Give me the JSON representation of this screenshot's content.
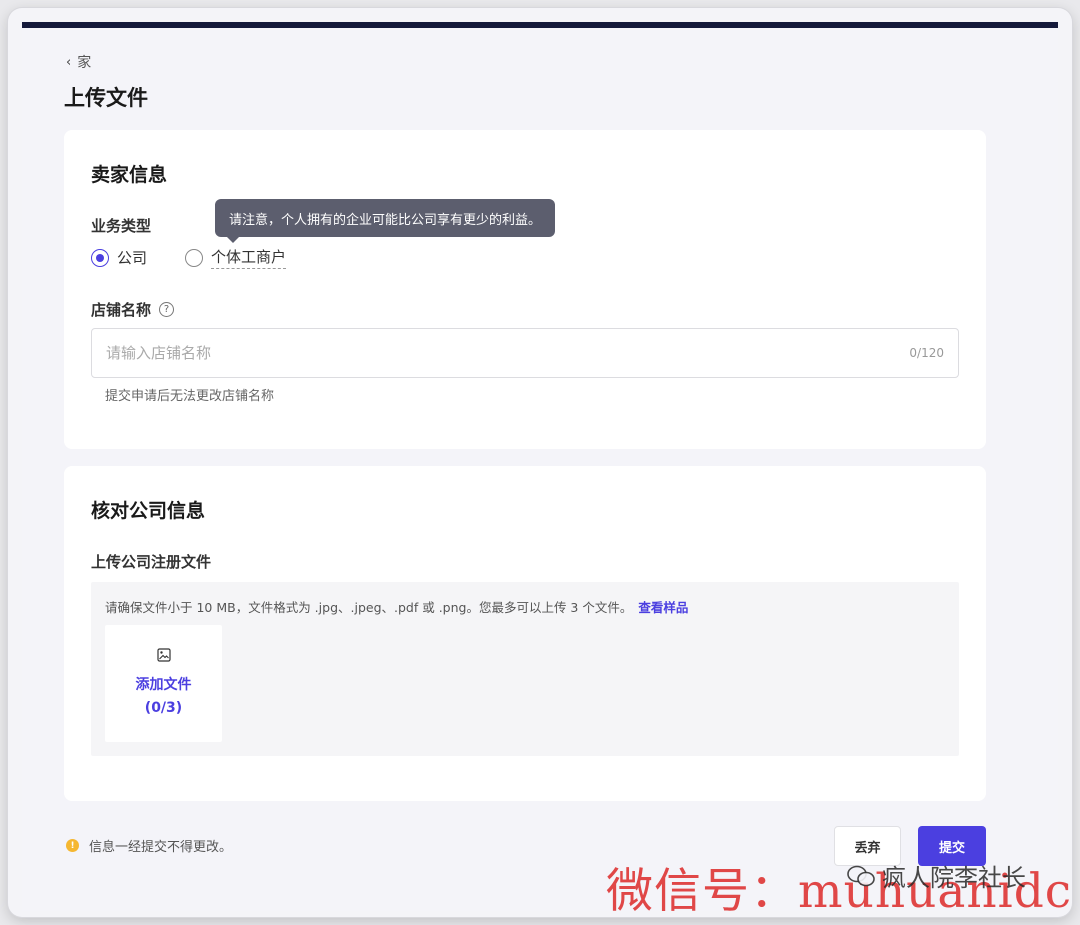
{
  "breadcrumb": {
    "back_label": "家"
  },
  "page": {
    "title": "上传文件"
  },
  "seller_info": {
    "title": "卖家信息",
    "business_type_label": "业务类型",
    "tooltip": "请注意，个人拥有的企业可能比公司享有更少的利益。",
    "options": [
      {
        "label": "公司",
        "checked": true
      },
      {
        "label": "个体工商户",
        "checked": false
      }
    ],
    "store_name_label": "店铺名称",
    "store_name_placeholder": "请输入店铺名称",
    "store_name_counter": "0/120",
    "store_name_hint": "提交申请后无法更改店铺名称"
  },
  "verify": {
    "title": "核对公司信息",
    "upload_label": "上传公司注册文件",
    "upload_note": "请确保文件小于 10 MB，文件格式为 .jpg、.jpeg、.pdf 或 .png。您最多可以上传 3 个文件。",
    "sample_link": "查看样品",
    "add_file_label": "添加文件",
    "add_file_count": "(0/3)"
  },
  "footer": {
    "note": "信息一经提交不得更改。",
    "discard_label": "丢弃",
    "submit_label": "提交"
  },
  "watermark": {
    "text": "微信号：muhuanidc",
    "account": "疯人院李社长"
  },
  "colors": {
    "accent": "#4b3fe0",
    "warning": "#f5b731",
    "topbar": "#14193a"
  }
}
